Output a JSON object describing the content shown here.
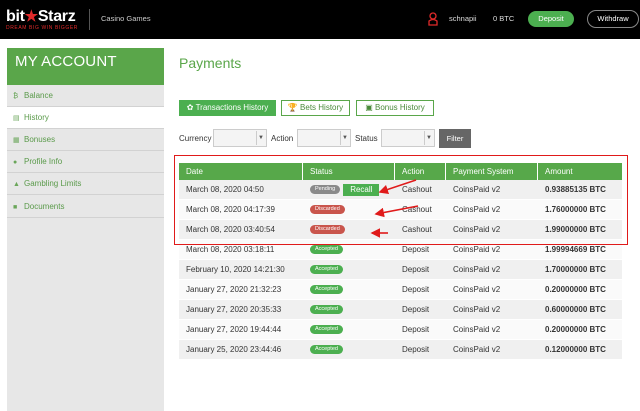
{
  "header": {
    "logo_text_1": "bit",
    "logo_star": "★",
    "logo_text_2": "Starz",
    "tagline": "DREAM BIG WIN BIGGER",
    "section": "Casino Games",
    "username": "schnapii",
    "balance": "0 BTC",
    "deposit_label": "Deposit",
    "withdraw_label": "Withdraw"
  },
  "sidebar": {
    "title": "MY ACCOUNT",
    "items": [
      {
        "label": "Balance",
        "icon": "₿"
      },
      {
        "label": "History",
        "icon": "▤"
      },
      {
        "label": "Bonuses",
        "icon": "▦"
      },
      {
        "label": "Profile Info",
        "icon": "●"
      },
      {
        "label": "Gambling Limits",
        "icon": "▲"
      },
      {
        "label": "Documents",
        "icon": "■"
      }
    ]
  },
  "main": {
    "title": "Payments",
    "tabs": [
      "✿ Transactions History",
      "🏆 Bets History",
      "▣ Bonus History"
    ],
    "filters": {
      "currency_label": "Currency",
      "action_label": "Action",
      "status_label": "Status",
      "filter_button": "Filter"
    },
    "table": {
      "headers": [
        "Date",
        "Status",
        "Action",
        "Payment System",
        "Amount"
      ],
      "rows": [
        {
          "date": "March 08, 2020 04:50",
          "status": "Pending",
          "status_type": "pending",
          "recall": "Recall",
          "action": "Cashout",
          "system": "CoinsPaid v2",
          "amount": "0.93885135 BTC"
        },
        {
          "date": "March 08, 2020 04:17:39",
          "status": "Discarded",
          "status_type": "discarded",
          "action": "Cashout",
          "system": "CoinsPaid v2",
          "amount": "1.76000000 BTC"
        },
        {
          "date": "March 08, 2020 03:40:54",
          "status": "Discarded",
          "status_type": "discarded",
          "action": "Cashout",
          "system": "CoinsPaid v2",
          "amount": "1.99000000 BTC"
        },
        {
          "date": "March 08, 2020 03:18:11",
          "status": "Accepted",
          "status_type": "accepted",
          "action": "Deposit",
          "system": "CoinsPaid v2",
          "amount": "1.99994669 BTC"
        },
        {
          "date": "February 10, 2020 14:21:30",
          "status": "Accepted",
          "status_type": "accepted",
          "action": "Deposit",
          "system": "CoinsPaid v2",
          "amount": "1.70000000 BTC"
        },
        {
          "date": "January 27, 2020 21:32:23",
          "status": "Accepted",
          "status_type": "accepted",
          "action": "Deposit",
          "system": "CoinsPaid v2",
          "amount": "0.20000000 BTC"
        },
        {
          "date": "January 27, 2020 20:35:33",
          "status": "Accepted",
          "status_type": "accepted",
          "action": "Deposit",
          "system": "CoinsPaid v2",
          "amount": "0.60000000 BTC"
        },
        {
          "date": "January 27, 2020 19:44:44",
          "status": "Accepted",
          "status_type": "accepted",
          "action": "Deposit",
          "system": "CoinsPaid v2",
          "amount": "0.20000000 BTC"
        },
        {
          "date": "January 25, 2020 23:44:46",
          "status": "Accepted",
          "status_type": "accepted",
          "action": "Deposit",
          "system": "CoinsPaid v2",
          "amount": "0.12000000 BTC"
        }
      ]
    }
  },
  "colors": {
    "brand_green": "#57a84a",
    "annotation_red": "#e01a1a"
  }
}
